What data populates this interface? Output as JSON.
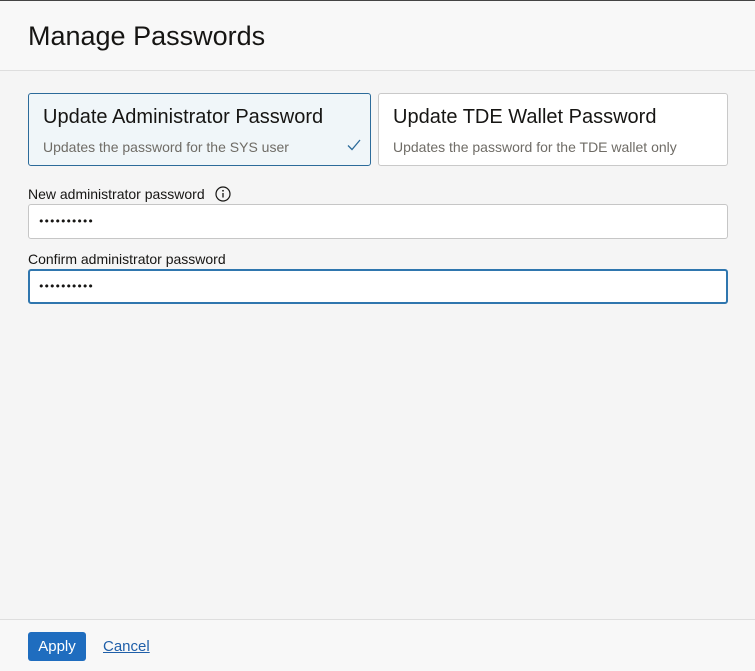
{
  "header": {
    "title": "Manage Passwords"
  },
  "options": [
    {
      "title": "Update Administrator Password",
      "description": "Updates the password for the SYS user",
      "selected": true
    },
    {
      "title": "Update TDE Wallet Password",
      "description": "Updates the password for the TDE wallet only",
      "selected": false
    }
  ],
  "fields": {
    "new_password": {
      "label": "New administrator password",
      "value": "••••••••••"
    },
    "confirm_password": {
      "label": "Confirm administrator password",
      "value": "••••••••••"
    }
  },
  "footer": {
    "apply_label": "Apply",
    "cancel_label": "Cancel"
  },
  "colors": {
    "accent": "#1f6dbf",
    "selected_border": "#2c6b9a",
    "selected_bg": "#f0f6f9"
  }
}
